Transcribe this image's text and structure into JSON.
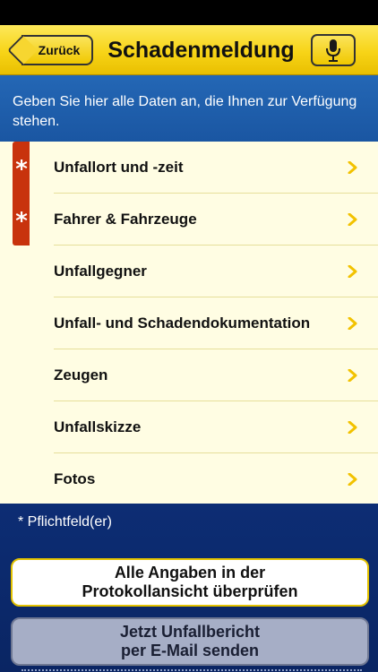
{
  "nav": {
    "back_label": "Zurück",
    "title": "Schadenmeldung",
    "mic_icon": "microphone-icon"
  },
  "banner": {
    "text": "Geben Sie hier alle Daten an, die Ihnen zur Verfügung stehen."
  },
  "menu": {
    "items": [
      {
        "label": "Unfallort und -zeit",
        "required": true
      },
      {
        "label": "Fahrer & Fahrzeuge",
        "required": true
      },
      {
        "label": "Unfallgegner",
        "required": false
      },
      {
        "label": "Unfall- und Schadendokumentation",
        "required": false
      },
      {
        "label": "Zeugen",
        "required": false
      },
      {
        "label": "Unfallskizze",
        "required": false
      },
      {
        "label": "Fotos",
        "required": false
      }
    ]
  },
  "footer": {
    "required_note": "* Pflichtfeld(er)",
    "review_line1": "Alle Angaben in der",
    "review_line2": "Protokollansicht überprüfen",
    "send_line1": "Jetzt Unfallbericht",
    "send_line2": "per E-Mail senden"
  },
  "colors": {
    "nav_yellow": "#f7d417",
    "required_red": "#c8330d",
    "chevron_yellow": "#f2c200",
    "list_bg": "#fffde3",
    "footer_blue": "#0c2a6c"
  }
}
